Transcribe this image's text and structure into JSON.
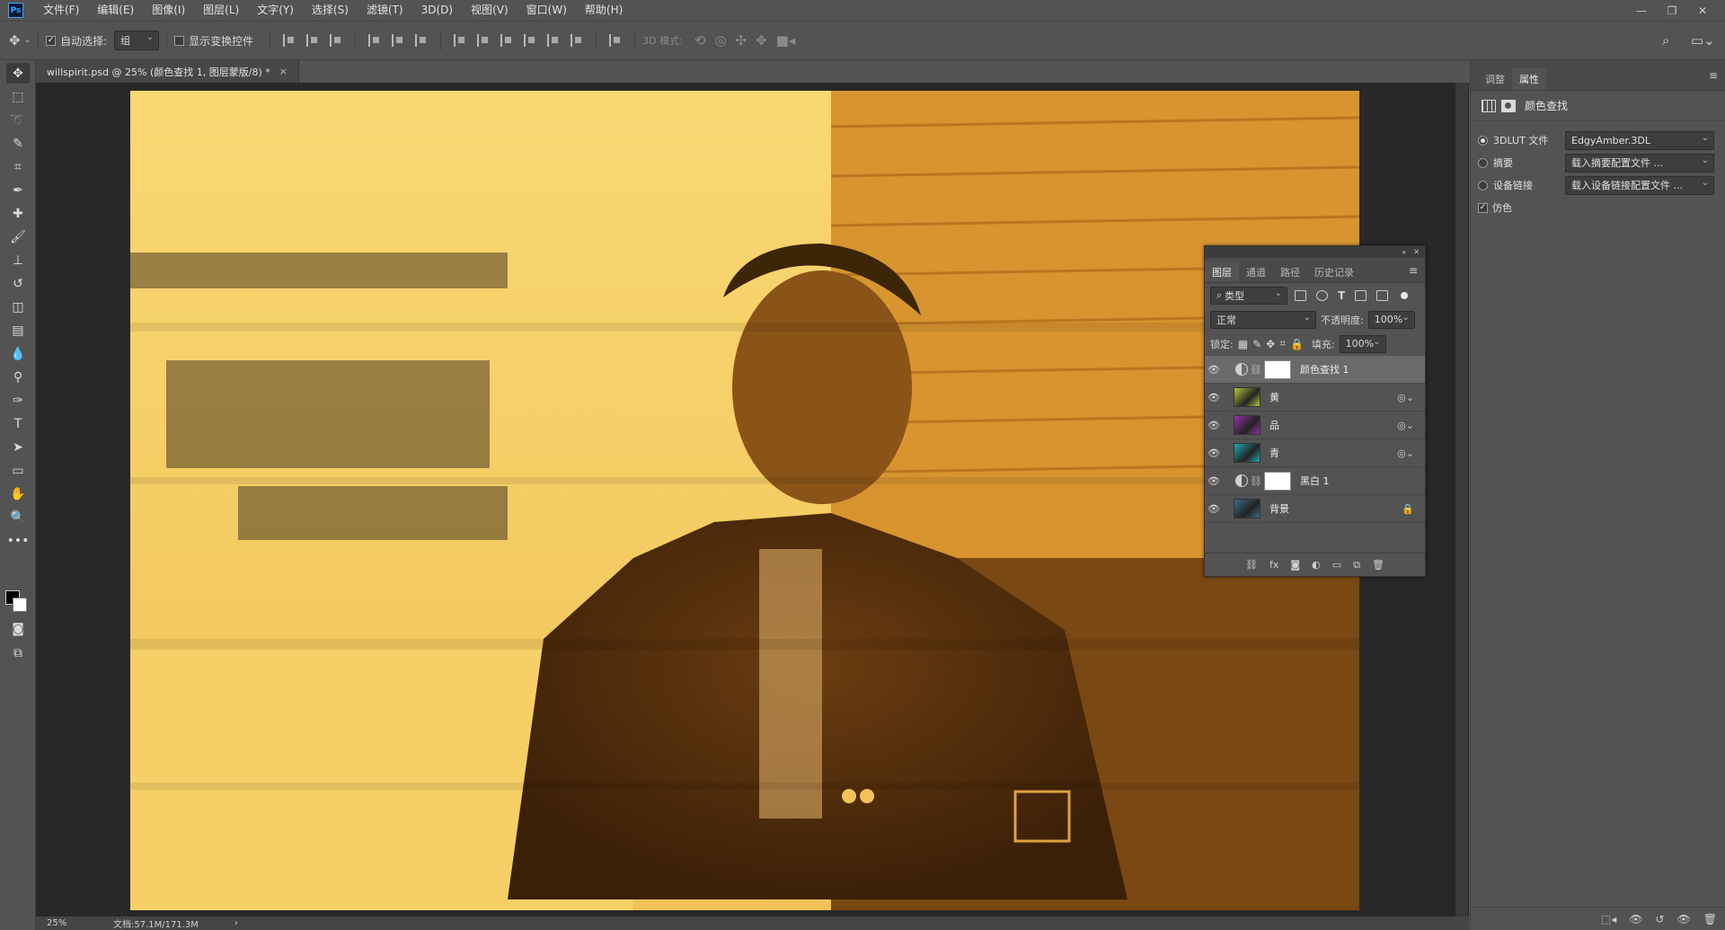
{
  "app": {
    "logo": "Ps"
  },
  "menu": [
    "文件(F)",
    "编辑(E)",
    "图像(I)",
    "图层(L)",
    "文字(Y)",
    "选择(S)",
    "滤镜(T)",
    "3D(D)",
    "视图(V)",
    "窗口(W)",
    "帮助(H)"
  ],
  "options": {
    "auto_select_label": "自动选择:",
    "auto_select_value": "组",
    "show_transform_label": "显示变换控件",
    "mode3d_label": "3D 模式:"
  },
  "document": {
    "tab_title": "willspirit.psd @ 25% (颜色查找 1, 图层蒙版/8) *",
    "close": "×"
  },
  "status": {
    "zoom": "25%",
    "doc_info": "文档:57.1M/171.3M",
    "arrow": "›"
  },
  "properties": {
    "tabs": [
      "调整",
      "属性"
    ],
    "selected_tab": "属性",
    "header_title": "颜色查找",
    "rows": [
      {
        "label": "3DLUT 文件",
        "value": "EdgyAmber.3DL",
        "selected": true
      },
      {
        "label": "摘要",
        "value": "载入摘要配置文件 ...",
        "selected": false
      },
      {
        "label": "设备链接",
        "value": "载入设备链接配置文件 ...",
        "selected": false
      }
    ],
    "dither_label": "仿色",
    "dither_checked": true
  },
  "layers_panel": {
    "tabs": [
      "图层",
      "通道",
      "路径",
      "历史记录"
    ],
    "filter_label": "类型",
    "blend_mode": "正常",
    "opacity_label": "不透明度:",
    "opacity_value": "100%",
    "lock_label": "锁定:",
    "fill_label": "填充:",
    "fill_value": "100%",
    "layers": [
      {
        "name": "颜色查找 1",
        "type": "adjustment",
        "selected": true
      },
      {
        "name": "黄",
        "type": "smart",
        "thumb_color": "#b6c43a"
      },
      {
        "name": "品",
        "type": "smart",
        "thumb_color": "#9a2fb0"
      },
      {
        "name": "青",
        "type": "smart",
        "thumb_color": "#1fa7b0"
      },
      {
        "name": "黑白 1",
        "type": "adjustment",
        "selected": false
      },
      {
        "name": "背景",
        "type": "background",
        "thumb_color": "#3c6a8a"
      }
    ]
  },
  "colors": {
    "canvas_amber": "#f0c45a",
    "canvas_dark": "#7a4a14",
    "accent": "#31a8ff"
  }
}
